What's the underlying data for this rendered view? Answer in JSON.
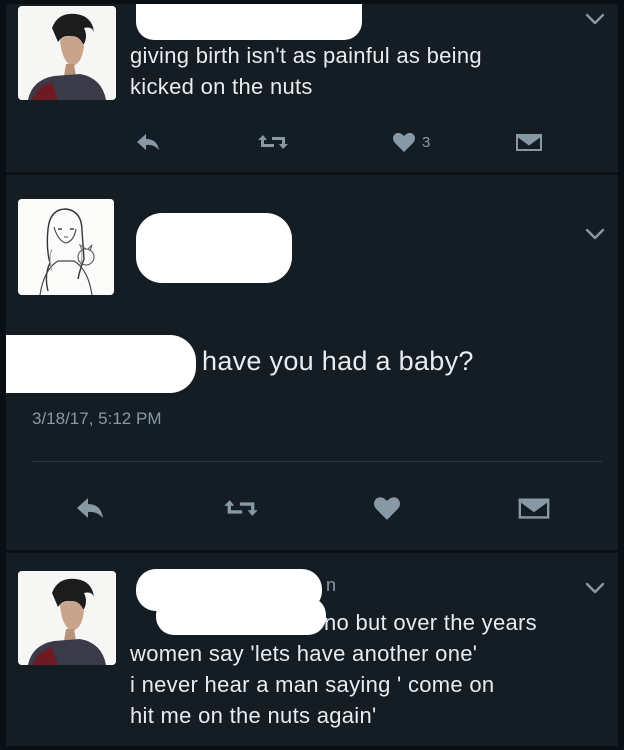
{
  "tweet1": {
    "text_line1": "giving birth isn't as painful as being",
    "text_line2": "kicked on the nuts",
    "like_count": "3"
  },
  "tweet2": {
    "text": "have you had a baby?",
    "timestamp": "3/18/17, 5:12 PM"
  },
  "tweet3": {
    "name_fragment": "n",
    "text_line1": "no but over the years",
    "text_line2": "women say 'lets have another one'",
    "text_line3": "i never hear a man saying ' come on",
    "text_line4": "hit me on the nuts again'"
  },
  "icons": {
    "reply": "reply-icon",
    "retweet": "retweet-icon",
    "like": "heart-icon",
    "dm": "envelope-icon",
    "menu": "chevron-down-icon"
  },
  "colors": {
    "background": "#141c24",
    "text": "#e8ecef",
    "muted": "#8899a6",
    "redaction": "#ffffff"
  }
}
